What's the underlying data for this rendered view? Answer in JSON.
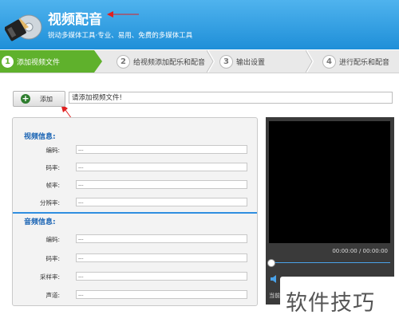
{
  "header": {
    "title": "视频配音",
    "subtitle": "锐动多媒体工具·专业、易用、免费的多媒体工具"
  },
  "steps": [
    {
      "num": "1",
      "label": "添加视频文件",
      "active": true
    },
    {
      "num": "2",
      "label": "给视频添加配乐和配音",
      "active": false
    },
    {
      "num": "3",
      "label": "输出设置",
      "active": false
    },
    {
      "num": "4",
      "label": "进行配乐和配音",
      "active": false
    }
  ],
  "add": {
    "button_label": "添加",
    "file_field_value": "请添加视频文件!"
  },
  "video_info": {
    "title": "视频信息:",
    "rows": [
      {
        "label": "编码:",
        "value": "---"
      },
      {
        "label": "码率:",
        "value": "---"
      },
      {
        "label": "帧率:",
        "value": "---"
      },
      {
        "label": "分辨率:",
        "value": "---"
      }
    ]
  },
  "audio_info": {
    "title": "音频信息:",
    "rows": [
      {
        "label": "编码:",
        "value": "---"
      },
      {
        "label": "码率:",
        "value": "---"
      },
      {
        "label": "采样率:",
        "value": "---"
      },
      {
        "label": "声道:",
        "value": "---"
      }
    ]
  },
  "player": {
    "time": "00:00:00 / 00:00:00",
    "current_label": "当前",
    "seek_fraction": 0
  },
  "watermark": "软件技巧",
  "colors": {
    "header_blue": "#1f8fd8",
    "step_active_green": "#5fb12c",
    "section_title_blue": "#1a64b4",
    "annotation_red": "#e02020"
  }
}
